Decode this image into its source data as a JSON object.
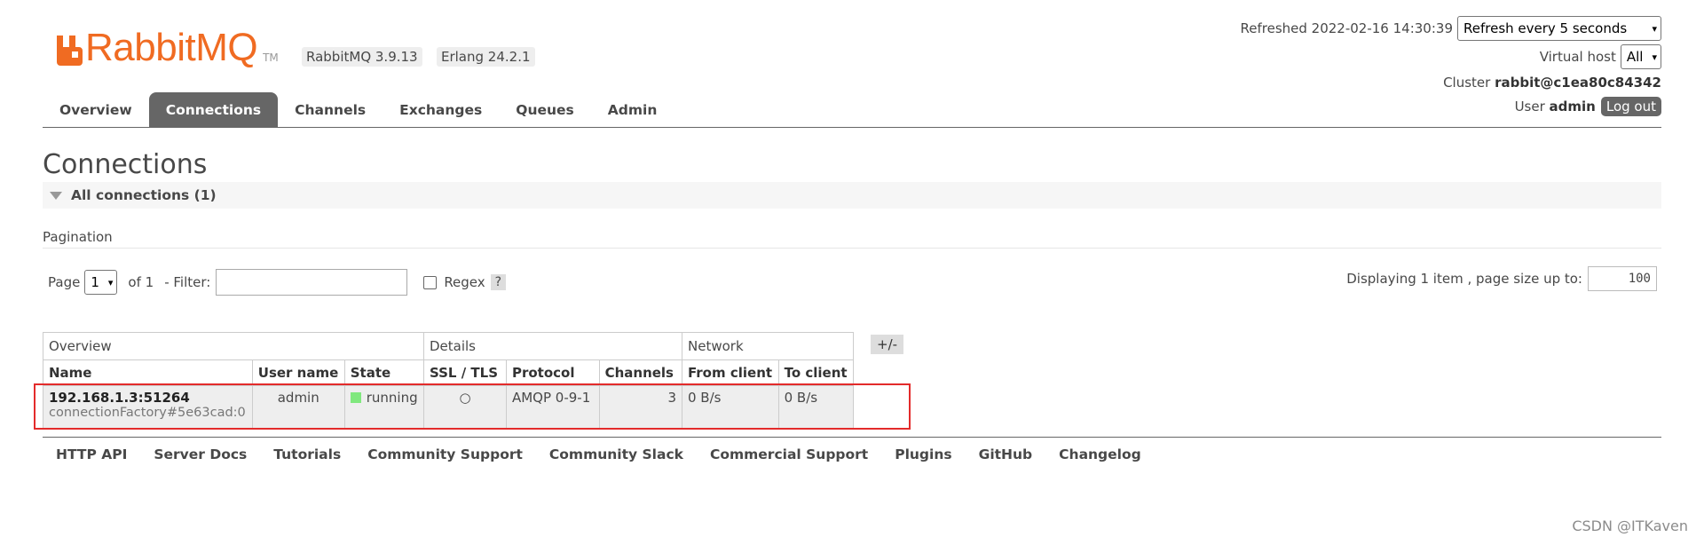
{
  "brand": {
    "logo_text": "RabbitMQ",
    "trademark": "TM",
    "accent_color": "#f06b22"
  },
  "versions": {
    "rabbitmq": "RabbitMQ 3.9.13",
    "erlang": "Erlang 24.2.1"
  },
  "status": {
    "refreshed": "Refreshed 2022-02-16 14:30:39",
    "refresh_option": "Refresh every 5 seconds",
    "vhost_label": "Virtual host",
    "vhost_value": "All",
    "cluster_label": "Cluster",
    "cluster_value": "rabbit@c1ea80c84342",
    "user_label": "User",
    "user_value": "admin",
    "logout": "Log out"
  },
  "nav": {
    "active": "Connections",
    "tabs": [
      "Overview",
      "Connections",
      "Channels",
      "Exchanges",
      "Queues",
      "Admin"
    ]
  },
  "page": {
    "title": "Connections",
    "section_title": "All connections (1)"
  },
  "pagination": {
    "label": "Pagination",
    "page_label": "Page",
    "page_value": "1",
    "of_label": "of 1",
    "filter_label": "- Filter:",
    "filter_value": "",
    "regex_label": "Regex",
    "regex_checked": false,
    "help": "?",
    "displaying": "Displaying 1 item , page size up to:",
    "page_size": "100"
  },
  "table": {
    "groups": [
      "Overview",
      "Details",
      "Network"
    ],
    "toggle": "+/-",
    "columns": [
      "Name",
      "User name",
      "State",
      "SSL / TLS",
      "Protocol",
      "Channels",
      "From client",
      "To client"
    ],
    "rows": [
      {
        "name": "192.168.1.3:51264",
        "client": "connectionFactory#5e63cad:0",
        "user": "admin",
        "state": "running",
        "ssl": "○",
        "protocol": "AMQP 0-9-1",
        "channels": "3",
        "from_client": "0 B/s",
        "to_client": "0 B/s"
      }
    ]
  },
  "footer": {
    "links": [
      "HTTP API",
      "Server Docs",
      "Tutorials",
      "Community Support",
      "Community Slack",
      "Commercial Support",
      "Plugins",
      "GitHub",
      "Changelog"
    ]
  },
  "watermark": "CSDN @ITKaven"
}
